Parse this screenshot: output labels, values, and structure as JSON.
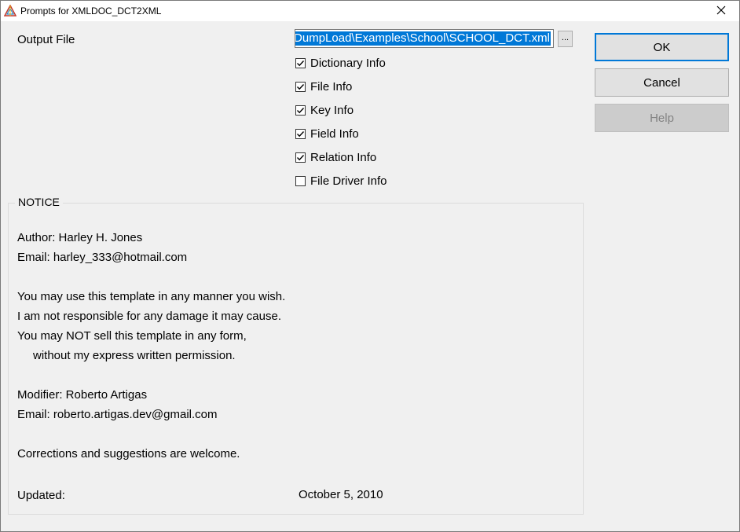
{
  "window": {
    "title": "Prompts for XMLDOC_DCT2XML",
    "close_glyph": "✕"
  },
  "output_file": {
    "label": "Output File",
    "value": ".DumpLoad\\Examples\\School\\SCHOOL_DCT.xml",
    "browse_label": "..."
  },
  "options": [
    {
      "label": "Dictionary Info",
      "checked": true
    },
    {
      "label": "File Info",
      "checked": true
    },
    {
      "label": "Key Info",
      "checked": true
    },
    {
      "label": "Field Info",
      "checked": true
    },
    {
      "label": "Relation Info",
      "checked": true
    },
    {
      "label": "File Driver Info",
      "checked": false
    }
  ],
  "buttons": {
    "ok": "OK",
    "cancel": "Cancel",
    "help": "Help"
  },
  "notice": {
    "legend": "NOTICE",
    "lines": [
      "Author: Harley H. Jones",
      "Email: harley_333@hotmail.com",
      "You may use this template in any manner you wish.",
      "I am not responsible for any damage it may cause.",
      "You may NOT sell this template in any form,",
      "without my express written permission.",
      "Modifier: Roberto Artigas",
      "Email: roberto.artigas.dev@gmail.com",
      "Corrections and suggestions are welcome."
    ],
    "updated_label": "Updated:",
    "updated_value": "October 5, 2010"
  },
  "icons": {
    "app": "app-triangle-icon",
    "close": "close-icon",
    "check": "checkmark-icon"
  },
  "colors": {
    "selection": "#0078d7",
    "default_button_border": "#0078d7",
    "dialog_background": "#f0f0f0"
  }
}
